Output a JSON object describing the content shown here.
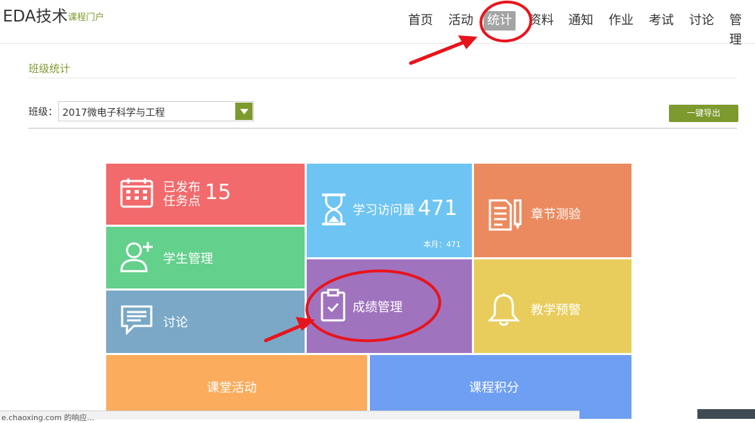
{
  "header": {
    "brand": "EDA技术",
    "brand_sub": "课程门户",
    "nav": [
      "首页",
      "活动",
      "统计",
      "资料",
      "通知",
      "作业",
      "考试",
      "讨论",
      "管理"
    ],
    "active_nav": "统计"
  },
  "section": {
    "title": "班级统计"
  },
  "filter": {
    "class_label": "班级：",
    "class_value": "2017微电子科学与工程",
    "export_label": "一键导出"
  },
  "tiles": {
    "tasks": {
      "label_line1": "已发布",
      "label_line2": "任务点",
      "count": "15",
      "icon": "calendar-icon"
    },
    "visits": {
      "label": "学习访问量",
      "count": "471",
      "note": "本月：471",
      "icon": "hourglass-icon"
    },
    "chapter": {
      "label": "章节测验",
      "icon": "document-pencil-icon"
    },
    "students": {
      "label": "学生管理",
      "icon": "add-user-icon"
    },
    "grades": {
      "label": "成绩管理",
      "icon": "clipboard-check-icon"
    },
    "warning": {
      "label": "教学预警",
      "icon": "bell-icon"
    },
    "discuss": {
      "label": "讨论",
      "icon": "chat-icon"
    },
    "classroom": {
      "label": "课堂活动"
    },
    "points": {
      "label": "课程积分"
    }
  },
  "colors": {
    "accent": "#7c9a2e",
    "tasks": "#f26a6c",
    "visits": "#6ec4f2",
    "chapter": "#ec8a5f",
    "students": "#63d08c",
    "grades": "#a073bf",
    "warning": "#e8cd5d",
    "discuss": "#7aa8c6",
    "classroom": "#fbac5c",
    "points": "#6e9ff2",
    "annotation": "#e8141c"
  },
  "status_bar": {
    "text": "e.chaoxing.com 的响应..."
  }
}
